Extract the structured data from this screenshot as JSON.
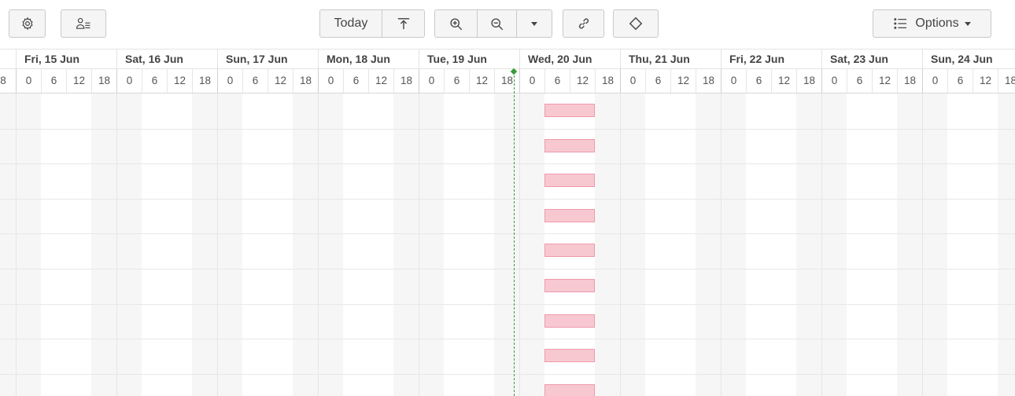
{
  "toolbar": {
    "settings_icon": "gear-icon",
    "resources_icon": "user-list-icon",
    "today_label": "Today",
    "scroll_to_task_icon": "scroll-to-task-icon",
    "zoom_in_icon": "zoom-in-icon",
    "zoom_out_icon": "zoom-out-icon",
    "zoom_more_icon": "chevron-down-icon",
    "link_icon": "link-icon",
    "milestone_icon": "diamond-icon",
    "options_icon": "list-icon",
    "options_label": "Options"
  },
  "timeline": {
    "days": [
      {
        "label": "Fri, 15 Jun"
      },
      {
        "label": "Sat, 16 Jun"
      },
      {
        "label": "Sun, 17 Jun"
      },
      {
        "label": "Mon, 18 Jun"
      },
      {
        "label": "Tue, 19 Jun"
      },
      {
        "label": "Wed, 20 Jun"
      },
      {
        "label": "Thu, 21 Jun"
      },
      {
        "label": "Fri, 22 Jun"
      },
      {
        "label": "Sat, 23 Jun"
      },
      {
        "label": "Sun, 24 Jun"
      }
    ],
    "partial_hour_label": "8",
    "hour_labels": [
      "0",
      "6",
      "12",
      "18"
    ],
    "trailing_partial_label": "1",
    "task_bar_count": 9
  },
  "colors": {
    "task_bar_fill": "#f8c8d1",
    "task_bar_border": "#ee9aac",
    "today_line": "#3a9b3a",
    "shade": "#f6f6f6"
  }
}
